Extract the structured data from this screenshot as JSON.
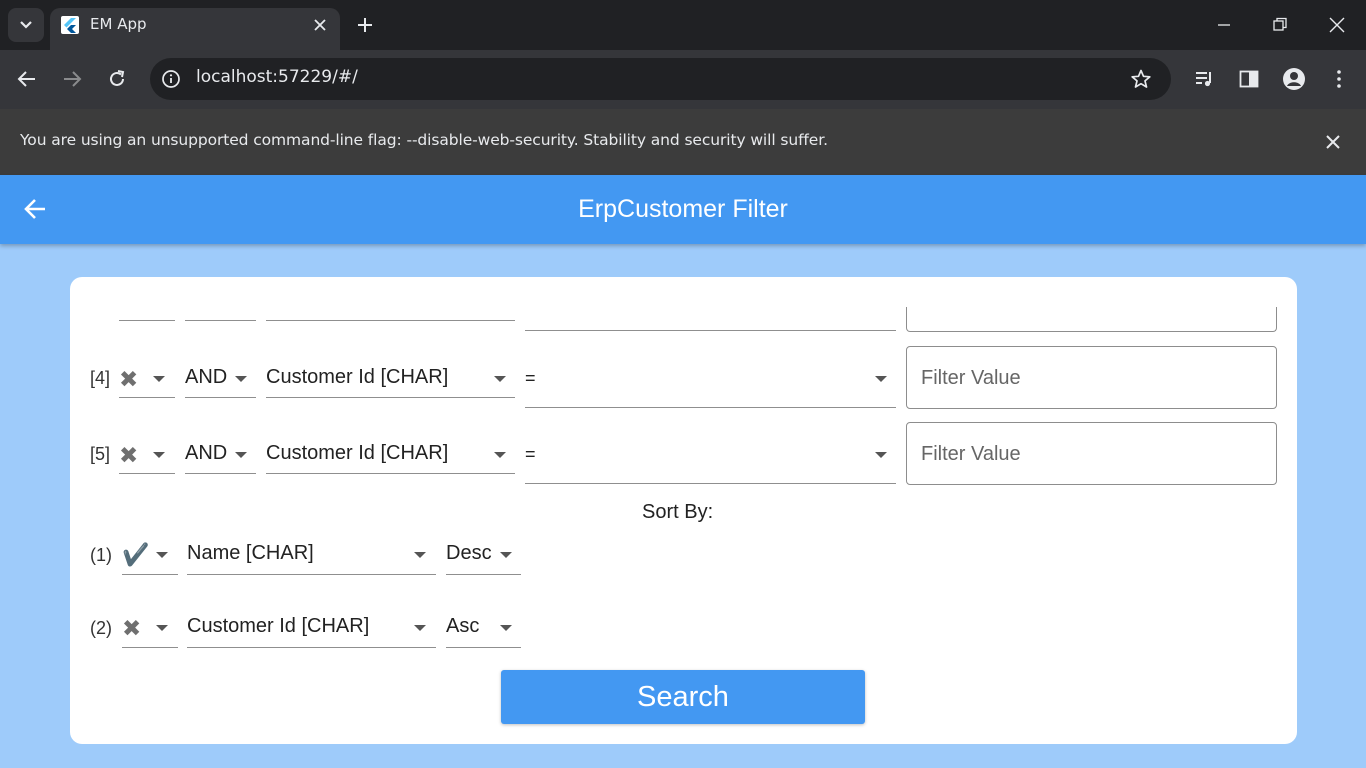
{
  "browser": {
    "tab_title": "EM App",
    "url": "localhost:57229/#/",
    "infobar_message": "You are using an unsupported command-line flag: --disable-web-security. Stability and security will suffer."
  },
  "app": {
    "title": "ErpCustomer Filter",
    "filters": [
      {
        "index": "[4]",
        "enabled_icon": "✖",
        "logic": "AND",
        "field": "Customer Id [CHAR]",
        "operator": "=",
        "value_placeholder": "Filter Value"
      },
      {
        "index": "[5]",
        "enabled_icon": "✖",
        "logic": "AND",
        "field": "Customer Id [CHAR]",
        "operator": "=",
        "value_placeholder": "Filter Value"
      }
    ],
    "sort_label": "Sort By:",
    "sorts": [
      {
        "index": "(1)",
        "enabled_icon": "✔️",
        "field": "Name [CHAR]",
        "direction": "Desc"
      },
      {
        "index": "(2)",
        "enabled_icon": "✖",
        "field": "Customer Id [CHAR]",
        "direction": "Asc"
      }
    ],
    "search_label": "Search"
  },
  "colors": {
    "appbar": "#4398f2",
    "background": "#9ecbfa",
    "button": "#4398f2"
  }
}
